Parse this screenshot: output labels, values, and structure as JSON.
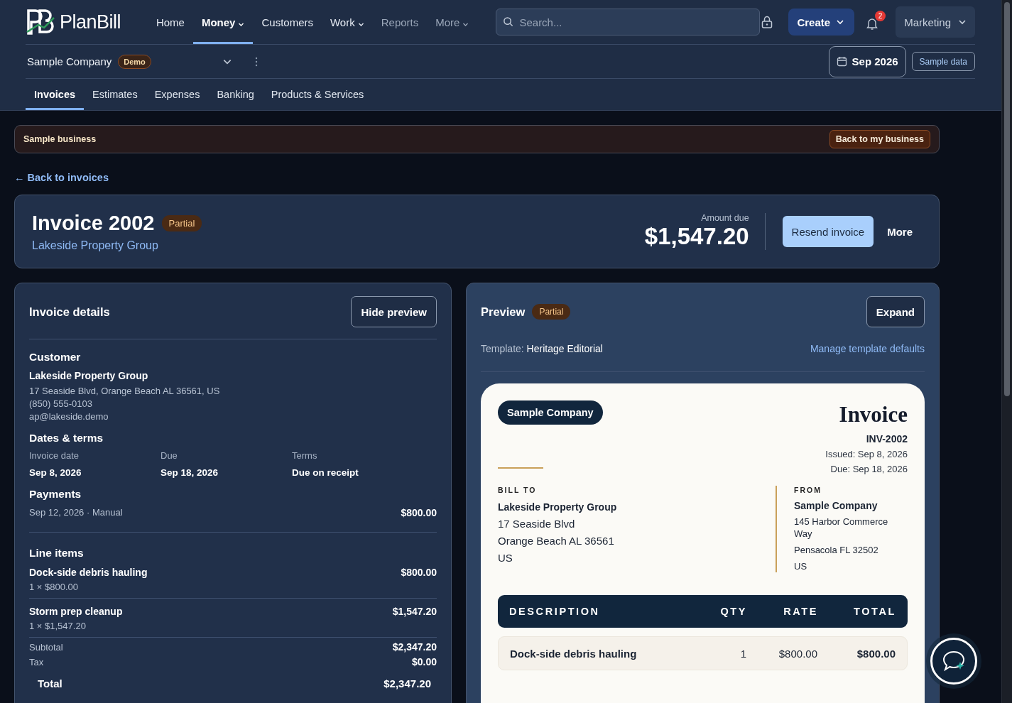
{
  "brand": {
    "name": "PlanBill"
  },
  "nav": [
    {
      "label": "Home",
      "selected": false,
      "has_menu": false,
      "dimmed": false
    },
    {
      "label": "Money",
      "selected": true,
      "has_menu": true,
      "dimmed": false
    },
    {
      "label": "Customers",
      "selected": false,
      "has_menu": false,
      "dimmed": false
    },
    {
      "label": "Work",
      "selected": false,
      "has_menu": true,
      "dimmed": false
    },
    {
      "label": "Reports",
      "selected": false,
      "has_menu": false,
      "dimmed": true
    },
    {
      "label": "More",
      "selected": false,
      "has_menu": true,
      "dimmed": true
    }
  ],
  "search": {
    "placeholder": "Search..."
  },
  "create_button": "Create",
  "notifications": {
    "count": "2"
  },
  "workspace": "Marketing",
  "company": {
    "name": "Sample Company",
    "badge": "Demo"
  },
  "period": "Sep 2026",
  "sample_data_button": "Sample data",
  "subnav": [
    {
      "label": "Invoices",
      "selected": true
    },
    {
      "label": "Estimates",
      "selected": false
    },
    {
      "label": "Expenses",
      "selected": false
    },
    {
      "label": "Banking",
      "selected": false
    },
    {
      "label": "Products & Services",
      "selected": false
    }
  ],
  "banner": {
    "text": "Sample business",
    "button": "Back to my business"
  },
  "back_link": "← Back to invoices",
  "invoice": {
    "title": "Invoice 2002",
    "status": "Partial",
    "customer": "Lakeside Property Group",
    "amount_label": "Amount due",
    "amount": "$1,547.20",
    "actions": [
      {
        "label": "Resend invoice",
        "kind": "primary"
      },
      {
        "label": "More",
        "kind": "plain"
      }
    ]
  },
  "details": {
    "title": "Invoice details",
    "toggle_button": "Hide preview",
    "customer": {
      "heading": "Customer",
      "name": "Lakeside Property Group",
      "lines": [
        "17 Seaside Blvd, Orange Beach AL 36561, US",
        "(850) 555-0103",
        "ap@lakeside.demo"
      ]
    },
    "dates": {
      "heading": "Dates & terms",
      "fields": [
        {
          "label": "Invoice date",
          "value": "Sep 8, 2026"
        },
        {
          "label": "Due",
          "value": "Sep 18, 2026"
        },
        {
          "label": "Terms",
          "value": "Due on receipt"
        }
      ]
    },
    "payments": {
      "heading": "Payments",
      "rows": [
        {
          "label": "Sep 12, 2026 · Manual",
          "amount": "$800.00"
        }
      ]
    },
    "line_items": {
      "heading": "Line items",
      "rows": [
        {
          "name": "Dock-side debris hauling",
          "detail": "1 × $800.00",
          "amount": "$800.00"
        },
        {
          "name": "Storm prep cleanup",
          "detail": "1 × $1,547.20",
          "amount": "$1,547.20"
        }
      ]
    },
    "totals": [
      {
        "label": "Subtotal",
        "value": "$2,347.20",
        "kind": "minor"
      },
      {
        "label": "Tax",
        "value": "$0.00",
        "kind": "minor"
      },
      {
        "label": "Total",
        "value": "$2,347.20",
        "kind": "grand"
      }
    ]
  },
  "preview": {
    "title": "Preview",
    "status": "Partial",
    "expand_button": "Expand",
    "template_label": "Template:",
    "template_name": "Heritage Editorial",
    "manage_link": "Manage template defaults",
    "document": {
      "company_badge": "Sample Company",
      "title": "Invoice",
      "number": "INV-2002",
      "issued": "Issued: Sep 8, 2026",
      "due": "Due: Sep 18, 2026",
      "bill_to": {
        "heading": "BILL TO",
        "name": "Lakeside Property Group",
        "lines": [
          "17 Seaside Blvd",
          "Orange Beach AL 36561",
          "US"
        ]
      },
      "from": {
        "heading": "FROM",
        "name": "Sample Company",
        "lines": [
          "145 Harbor Commerce Way",
          "Pensacola FL 32502",
          "US"
        ]
      },
      "columns": [
        "DESCRIPTION",
        "QTY",
        "RATE",
        "TOTAL"
      ],
      "rows": [
        [
          "Dock-side debris hauling",
          "1",
          "$800.00",
          "$800.00"
        ]
      ]
    }
  }
}
